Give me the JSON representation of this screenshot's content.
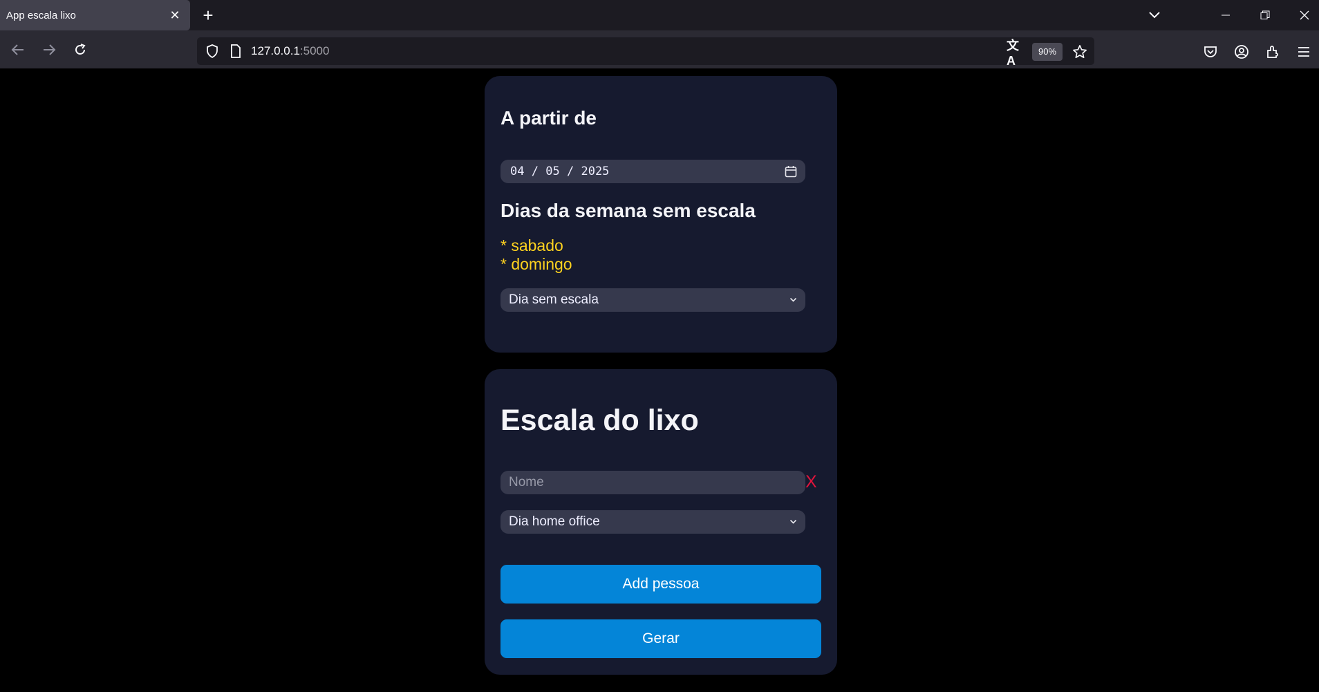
{
  "browser": {
    "tab_title": "App escala lixo",
    "url_host": "127.0.0.1",
    "url_port": ":5000",
    "zoom": "90%"
  },
  "date_card": {
    "heading": "A partir de",
    "date_month": "04",
    "date_day": "05",
    "date_year": "2025",
    "date_sep": "/",
    "no_schedule_heading": "Dias da semana sem escala",
    "no_schedule_days": [
      "* sabado",
      "* domingo"
    ],
    "no_schedule_select": "Dia sem escala"
  },
  "schedule_card": {
    "title": "Escala do lixo",
    "name_placeholder": "Nome",
    "remove_label": "X",
    "home_office_select": "Dia home office",
    "add_button": "Add pessoa",
    "generate_button": "Gerar"
  },
  "colors": {
    "page_bg": "#000000",
    "card_bg": "#161a2f",
    "field_bg": "#36394d",
    "accent_button": "#0485d8",
    "highlight_text": "#ffd21f",
    "danger": "#e0143c"
  },
  "icons": [
    "shield-icon",
    "page-icon",
    "translate-icon",
    "star-icon",
    "pocket-icon",
    "account-icon",
    "extensions-icon",
    "menu-icon",
    "calendar-icon",
    "chevron-down-icon"
  ]
}
